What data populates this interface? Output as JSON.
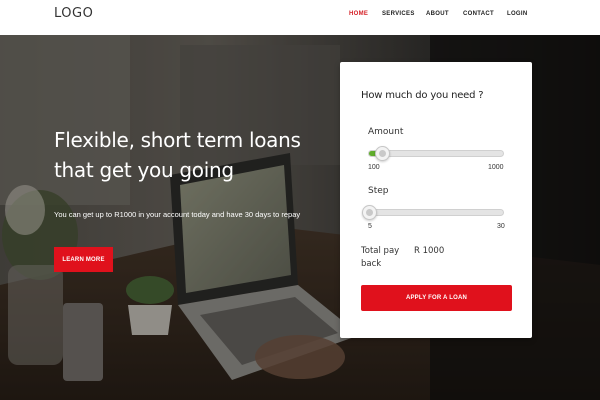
{
  "navbar": {
    "logo": "LOGO",
    "links": [
      {
        "label": "HOME",
        "active": true
      },
      {
        "label": "SERVICES",
        "active": false
      },
      {
        "label": "ABOUT",
        "active": false
      },
      {
        "label": "CONTACT",
        "active": false
      },
      {
        "label": "LOGIN",
        "active": false
      }
    ]
  },
  "hero": {
    "headline": "Flexible, short term loans that get you going",
    "subline": "You can get up to R1000 in your account today and have 30 days to repay",
    "learn_more_label": "LEARN MORE"
  },
  "loan_form": {
    "title": "How much do you need ?",
    "amount": {
      "label": "Amount",
      "min": "100",
      "max": "1000",
      "value": 100,
      "fraction": 0.1
    },
    "step": {
      "label": "Step",
      "min": "5",
      "max": "30",
      "value": 5,
      "fraction": 0.0
    },
    "total_label": "Total pay back",
    "total_value": "R 1000",
    "apply_label": "APPLY FOR A LOAN"
  },
  "colors": {
    "accent": "#e0111c",
    "active_nav": "#d41f26",
    "slider_fill": "#5fad2c"
  },
  "icons": [
    "slider-thumb"
  ]
}
